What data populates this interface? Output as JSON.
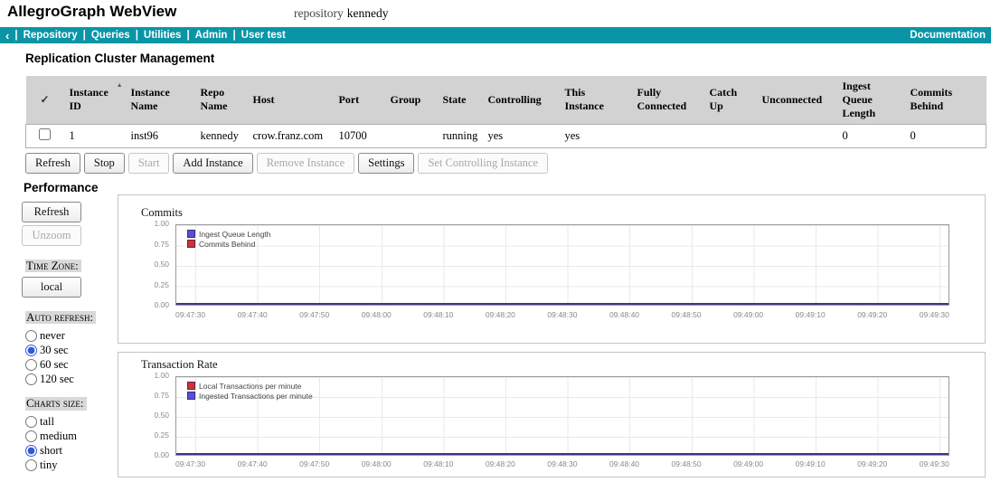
{
  "header": {
    "app_title": "AllegroGraph WebView",
    "repo_label": "repository",
    "repo_value": "kennedy"
  },
  "nav": {
    "back": "‹",
    "separator": "|",
    "items": [
      "Repository",
      "Queries",
      "Utilities",
      "Admin",
      "User test"
    ],
    "documentation": "Documentation"
  },
  "cluster": {
    "title": "Replication Cluster Management",
    "table": {
      "select_all_mark": "✓",
      "sort_indicator": "▲",
      "headers": [
        "Instance ID",
        "Instance Name",
        "Repo Name",
        "Host",
        "Port",
        "Group",
        "State",
        "Controlling",
        "This Instance",
        "Fully Connected",
        "Catch Up",
        "Unconnected",
        "Ingest Queue Length",
        "Commits Behind"
      ],
      "row": {
        "instance_id": "1",
        "instance_name": "inst96",
        "repo_name": "kennedy",
        "host": "crow.franz.com",
        "port": "10700",
        "group": "",
        "state": "running",
        "controlling": "yes",
        "this_instance": "yes",
        "fully_connected": "",
        "catch_up": "",
        "unconnected": "",
        "ingest_queue_length": "0",
        "commits_behind": "0"
      }
    },
    "actions": {
      "refresh": "Refresh",
      "stop": "Stop",
      "start": "Start",
      "add_instance": "Add Instance",
      "remove_instance": "Remove Instance",
      "settings": "Settings",
      "set_controlling": "Set Controlling Instance"
    }
  },
  "performance": {
    "title": "Performance",
    "refresh": "Refresh",
    "unzoom": "Unzoom",
    "time_zone_label": "Time Zone:",
    "time_zone_value": "local",
    "auto_refresh_label": "Auto refresh:",
    "auto_refresh_options": [
      "never",
      "30 sec",
      "60 sec",
      "120 sec"
    ],
    "auto_refresh_selected": "30 sec",
    "charts_size_label": "Charts size:",
    "charts_size_options": [
      "tall",
      "medium",
      "short",
      "tiny"
    ],
    "charts_size_selected": "short"
  },
  "chart_data": [
    {
      "type": "line",
      "title": "Commits",
      "legend_position": "top-left",
      "grid": true,
      "ylim": [
        0,
        1
      ],
      "y_ticks": [
        "1.00",
        "0.75",
        "0.50",
        "0.25",
        "0.00"
      ],
      "x_ticks": [
        "09:47:30",
        "09:47:40",
        "09:47:50",
        "09:48:00",
        "09:48:10",
        "09:48:20",
        "09:48:30",
        "09:48:40",
        "09:48:50",
        "09:49:00",
        "09:49:10",
        "09:49:20",
        "09:49:30"
      ],
      "legend": [
        {
          "label": "Ingest Queue Length",
          "color": "#5a4fcf"
        },
        {
          "label": "Commits Behind",
          "color": "#cc3333"
        }
      ],
      "series": [
        {
          "name": "Ingest Queue Length",
          "color": "#5a4fcf",
          "values": [
            0,
            0,
            0,
            0,
            0,
            0,
            0,
            0,
            0,
            0,
            0,
            0,
            0
          ]
        },
        {
          "name": "Commits Behind",
          "color": "#cc3333",
          "values": [
            0,
            0,
            0,
            0,
            0,
            0,
            0,
            0,
            0,
            0,
            0,
            0,
            0
          ]
        }
      ],
      "line_color": "#46308c"
    },
    {
      "type": "line",
      "title": "Transaction Rate",
      "legend_position": "top-left",
      "grid": true,
      "ylim": [
        0,
        1
      ],
      "y_ticks": [
        "1.00",
        "0.75",
        "0.50",
        "0.25",
        "0.00"
      ],
      "x_ticks": [
        "09:47:30",
        "09:47:40",
        "09:47:50",
        "09:48:00",
        "09:48:10",
        "09:48:20",
        "09:48:30",
        "09:48:40",
        "09:48:50",
        "09:49:00",
        "09:49:10",
        "09:49:20",
        "09:49:30"
      ],
      "legend": [
        {
          "label": "Local Transactions per minute",
          "color": "#cc3333"
        },
        {
          "label": "Ingested Transactions per minute",
          "color": "#5a4fcf"
        }
      ],
      "series": [
        {
          "name": "Local Transactions per minute",
          "color": "#cc3333",
          "values": [
            0,
            0,
            0,
            0,
            0,
            0,
            0,
            0,
            0,
            0,
            0,
            0,
            0
          ]
        },
        {
          "name": "Ingested Transactions per minute",
          "color": "#5a4fcf",
          "values": [
            0,
            0,
            0,
            0,
            0,
            0,
            0,
            0,
            0,
            0,
            0,
            0,
            0
          ]
        }
      ],
      "line_color": "#46308c"
    }
  ]
}
